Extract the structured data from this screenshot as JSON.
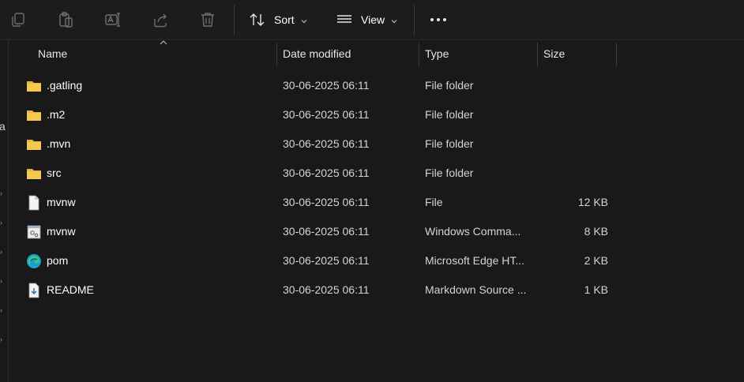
{
  "toolbar": {
    "sort_label": "Sort",
    "view_label": "View",
    "buttons": [
      "copy-icon",
      "paste-icon",
      "rename-icon",
      "share-icon",
      "delete-icon"
    ]
  },
  "left_pane": {
    "visible_char": "a"
  },
  "columns": {
    "name": "Name",
    "date": "Date modified",
    "type": "Type",
    "size": "Size"
  },
  "files": [
    {
      "name": ".gatling",
      "date": "30-06-2025 06:11",
      "type": "File folder",
      "size": "",
      "icon": "folder-icon"
    },
    {
      "name": ".m2",
      "date": "30-06-2025 06:11",
      "type": "File folder",
      "size": "",
      "icon": "folder-icon"
    },
    {
      "name": ".mvn",
      "date": "30-06-2025 06:11",
      "type": "File folder",
      "size": "",
      "icon": "folder-icon"
    },
    {
      "name": "src",
      "date": "30-06-2025 06:11",
      "type": "File folder",
      "size": "",
      "icon": "folder-icon"
    },
    {
      "name": "mvnw",
      "date": "30-06-2025 06:11",
      "type": "File",
      "size": "12 KB",
      "icon": "file-icon"
    },
    {
      "name": "mvnw",
      "date": "30-06-2025 06:11",
      "type": "Windows Comma...",
      "size": "8 KB",
      "icon": "cmd-script-icon"
    },
    {
      "name": "pom",
      "date": "30-06-2025 06:11",
      "type": "Microsoft Edge HT...",
      "size": "2 KB",
      "icon": "edge-icon"
    },
    {
      "name": "README",
      "date": "30-06-2025 06:11",
      "type": "Markdown Source ...",
      "size": "1 KB",
      "icon": "markdown-icon"
    }
  ],
  "colors": {
    "background": "#191919",
    "folder": "#f3c650",
    "text": "#ffffff",
    "edge": "#1f9bd7"
  }
}
